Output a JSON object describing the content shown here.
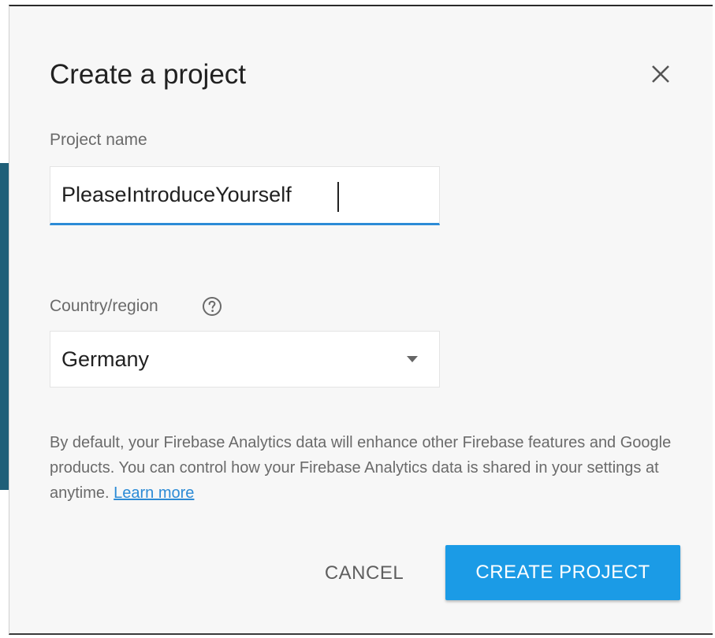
{
  "dialog": {
    "title": "Create a project",
    "close_icon": "close-icon"
  },
  "project_name": {
    "label": "Project name",
    "value": "PleaseIntroduceYourself"
  },
  "country": {
    "label": "Country/region",
    "help_icon": "help-icon",
    "selected": "Germany",
    "dropdown_icon": "chevron-down-icon"
  },
  "disclaimer": {
    "text": "By default, your Firebase Analytics data will enhance other Firebase features and Google products. You can control how your Firebase Analytics data is shared in your settings at anytime.",
    "link": "Learn more"
  },
  "actions": {
    "cancel": "CANCEL",
    "create": "CREATE PROJECT"
  },
  "colors": {
    "accent": "#1b9be6",
    "input_underline": "#2c8bd6",
    "background": "#f7f7f7"
  }
}
